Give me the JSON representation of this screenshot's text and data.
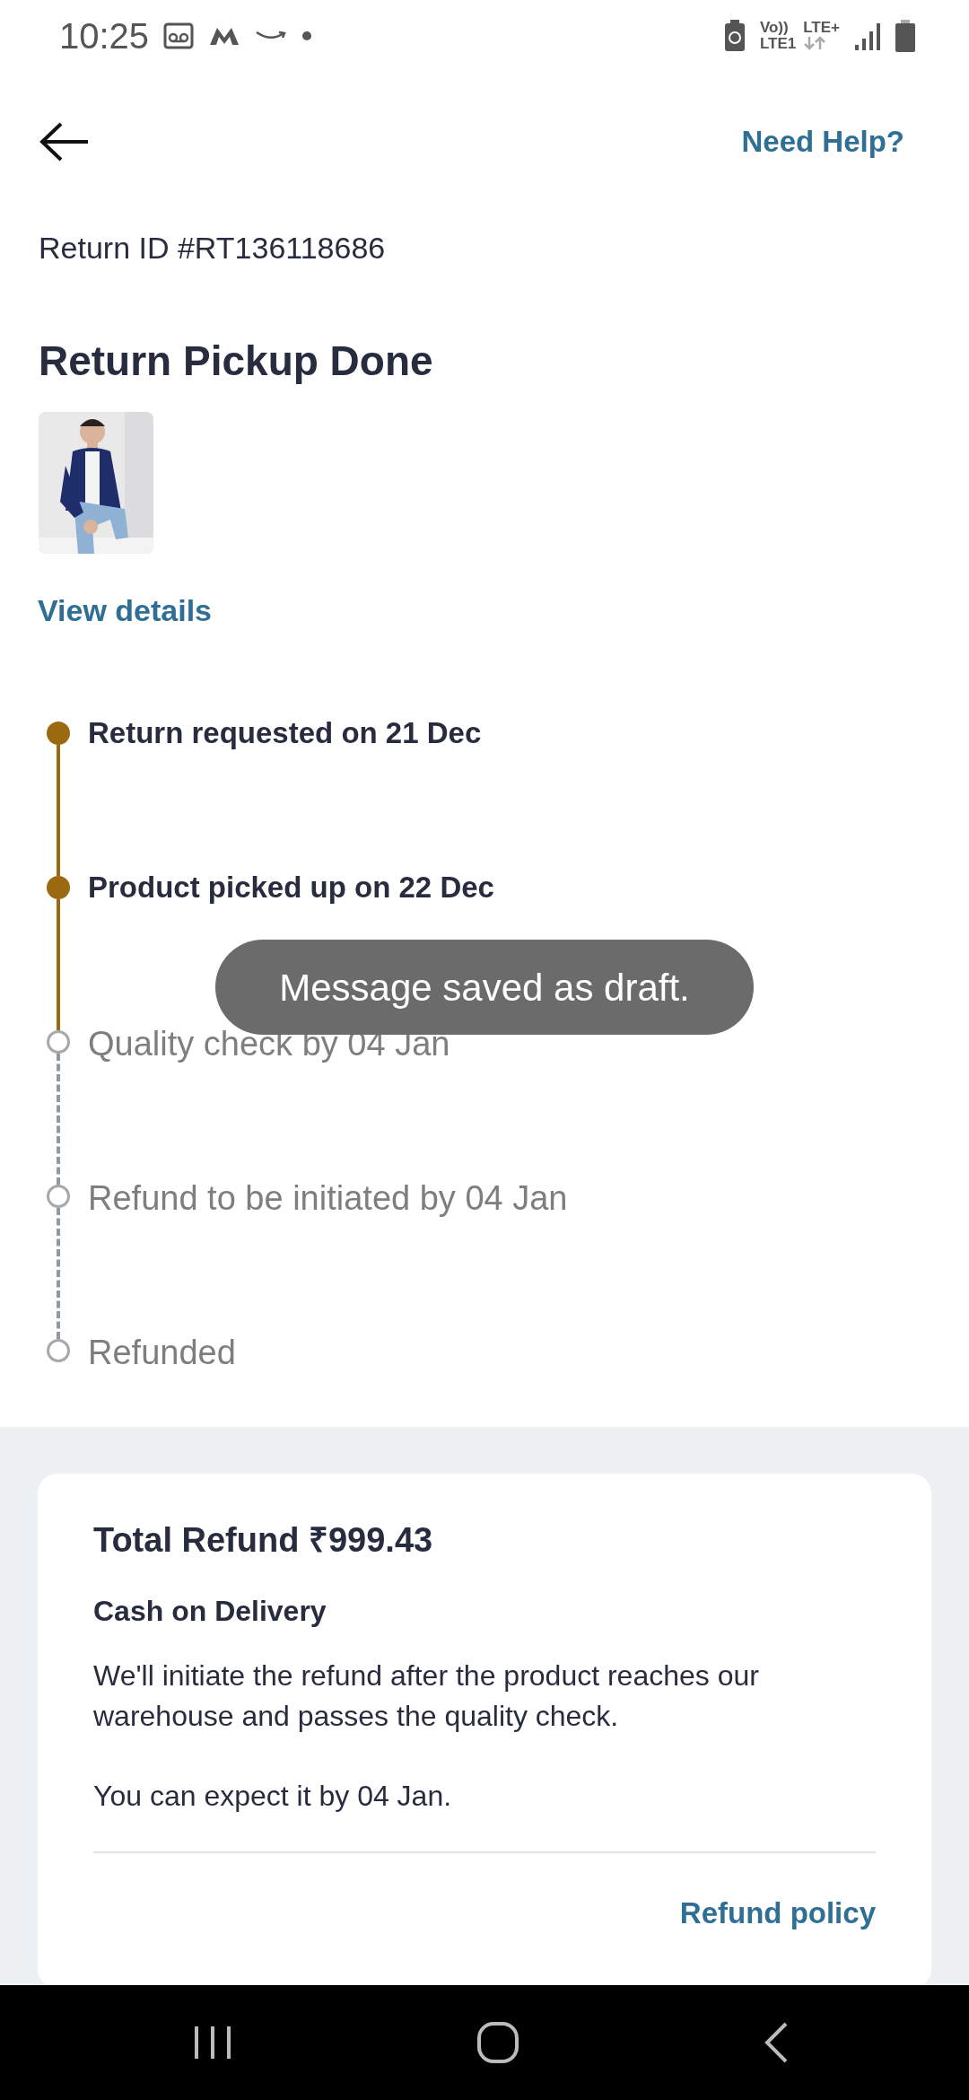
{
  "status_bar": {
    "time": "10:25",
    "network_labels": [
      "Vo))",
      "LTE+",
      "LTE1"
    ]
  },
  "header": {
    "help_link": "Need Help?"
  },
  "return_id": "Return ID #RT136118686",
  "status_title": "Return Pickup Done",
  "view_details": "View details",
  "timeline": [
    {
      "label": "Return requested on 21 Dec",
      "completed": true
    },
    {
      "label": "Product picked up on 22 Dec",
      "completed": true
    },
    {
      "label": "Quality check by 04 Jan",
      "completed": false
    },
    {
      "label": "Refund to be initiated by 04 Jan",
      "completed": false
    },
    {
      "label": "Refunded",
      "completed": false
    }
  ],
  "toast": "Message saved as draft.",
  "refund_card": {
    "title": "Total Refund ₹999.43",
    "method": "Cash on Delivery",
    "description": "We'll initiate the refund after the product reaches our warehouse and passes the quality check.",
    "expected": "You can expect it by 04 Jan.",
    "policy_link": "Refund policy"
  }
}
